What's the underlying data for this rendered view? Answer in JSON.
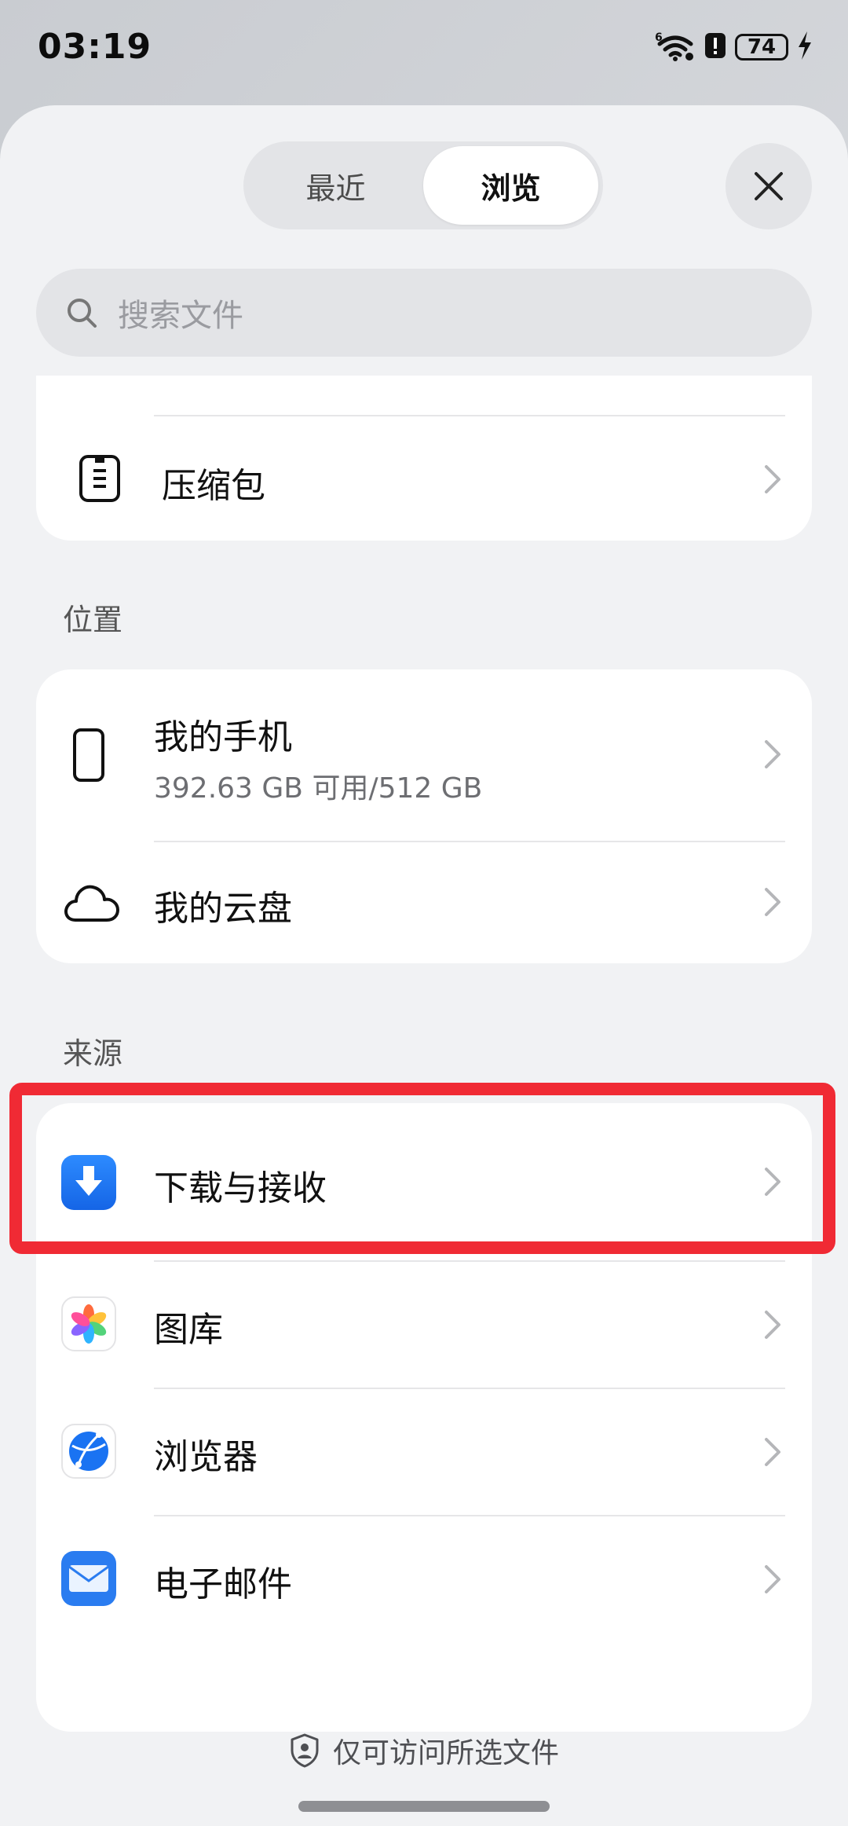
{
  "status_bar": {
    "time": "03:19",
    "battery": "74",
    "icons": [
      "wifi-6-icon",
      "alert-icon",
      "battery-icon",
      "charging-icon"
    ]
  },
  "tabs": [
    {
      "label": "最近",
      "active": false
    },
    {
      "label": "浏览",
      "active": true
    }
  ],
  "search": {
    "placeholder": "搜索文件"
  },
  "categories": {
    "items": [
      {
        "label": "压缩包",
        "icon": "archive-icon"
      }
    ]
  },
  "locations": {
    "title": "位置",
    "items": [
      {
        "label": "我的手机",
        "sub": "392.63 GB 可用/512 GB",
        "icon": "phone-icon"
      },
      {
        "label": "我的云盘",
        "icon": "cloud-icon"
      }
    ]
  },
  "sources": {
    "title": "来源",
    "items": [
      {
        "label": "下载与接收",
        "icon": "download-icon"
      },
      {
        "label": "图库",
        "icon": "gallery-icon"
      },
      {
        "label": "浏览器",
        "icon": "browser-icon"
      },
      {
        "label": "电子邮件",
        "icon": "email-icon"
      }
    ]
  },
  "footer": {
    "note": "仅可访问所选文件"
  },
  "colors": {
    "highlight": "#f02a34",
    "download_blue": "#1a73f2",
    "email_blue": "#2a7cf0"
  }
}
